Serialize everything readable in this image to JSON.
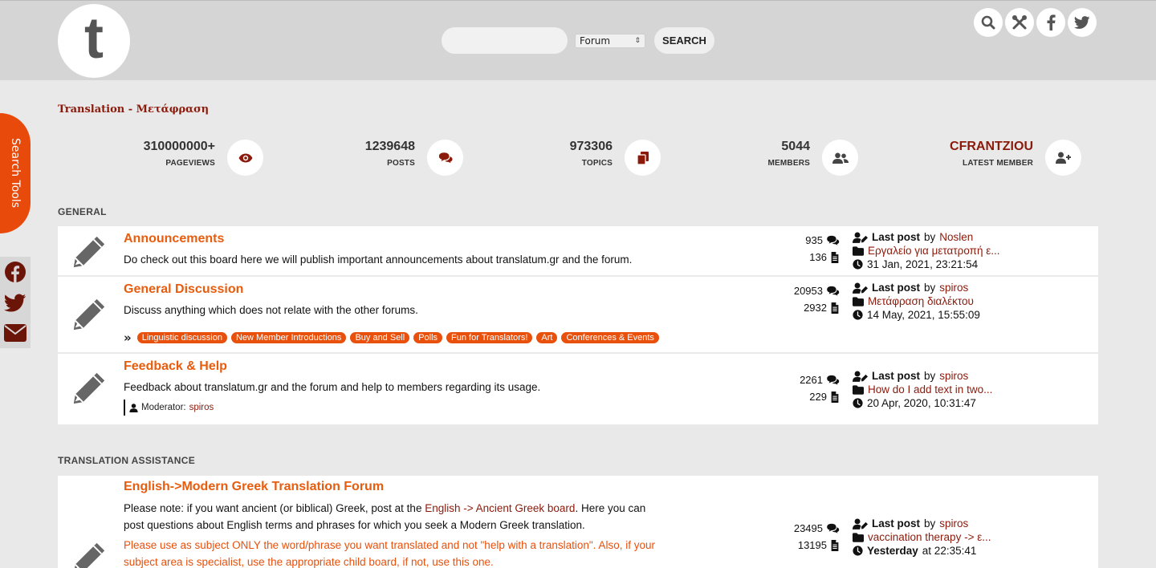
{
  "header": {
    "logo_letter": "t",
    "search_placeholder": "",
    "search_scope": "Forum",
    "search_button": "SEARCH",
    "icons": [
      "search-icon",
      "tools-icon",
      "facebook-icon",
      "twitter-icon"
    ]
  },
  "side": {
    "search_tools": "Search Tools",
    "social": [
      "facebook-icon",
      "twitter-icon",
      "envelope-icon"
    ]
  },
  "breadcrumb": "Translation - Μετάφραση",
  "stats": [
    {
      "value": "310000000+",
      "label": "PAGEVIEWS",
      "icon": "eye-icon"
    },
    {
      "value": "1239648",
      "label": "POSTS",
      "icon": "comments-icon"
    },
    {
      "value": "973306",
      "label": "TOPICS",
      "icon": "copy-icon"
    },
    {
      "value": "5044",
      "label": "MEMBERS",
      "icon": "users-icon"
    },
    {
      "value": "CFRANTZIOU",
      "label": "LATEST MEMBER",
      "icon": "user-plus-icon"
    }
  ],
  "sections": {
    "general": "GENERAL",
    "translation_assistance": "TRANSLATION ASSISTANCE"
  },
  "labels": {
    "last_post": "Last post",
    "by": "by",
    "moderator": "Moderator:",
    "subforum_marker": "»"
  },
  "forums": [
    {
      "title": "Announcements",
      "description": "Do check out this board here we will publish important announcements about translatum.gr and the forum.",
      "posts": "935",
      "topics": "136",
      "last_user": "Noslen",
      "last_topic": "Εργαλείο για μετατροπή ε...",
      "last_time": "31 Jan, 2021, 23:21:54"
    },
    {
      "title": "General Discussion",
      "description": "Discuss anything which does not relate with the other forums.",
      "subforums": [
        "Linguistic discussion",
        "New Member Introductions",
        "Buy and Sell",
        "Polls",
        "Fun for Translators!",
        "Art",
        "Conferences & Events"
      ],
      "posts": "20953",
      "topics": "2932",
      "last_user": "spiros",
      "last_topic": "Μετάφραση διαλέκτου",
      "last_time": "14 May, 2021, 15:55:09"
    },
    {
      "title": "Feedback & Help",
      "description": "Feedback about translatum.gr and the forum and help to members regarding its usage.",
      "moderator": "spiros",
      "posts": "2261",
      "topics": "229",
      "last_user": "spiros",
      "last_topic": "How do I add text in two...",
      "last_time": "20 Apr, 2020, 10:31:47"
    },
    {
      "title": "English->Modern Greek Translation Forum",
      "description_line1_pre": "Please note: if you want ancient (or biblical) Greek, post at the ",
      "description_line1_link": "English -> Ancient Greek board",
      "description_line1_post": ". Here you can",
      "description_line2": "post questions about English terms and phrases for which you seek a Modern Greek translation.",
      "notice_line1": "Please use as subject ONLY the word/phrase you want translated and not \"help with a translation\". Also, if your",
      "notice_line2": "subject area is specialist, use the appropriate child board, if not, use this one.",
      "posts": "23495",
      "topics": "13195",
      "last_user": "spiros",
      "last_topic": "vaccination therapy -> ε...",
      "last_time_day": "Yesterday",
      "last_time_rest": "at 22:35:41"
    }
  ],
  "colors": {
    "accent": "#e8500c",
    "dark_red": "#8b1a0b",
    "header_bg": "#d5d5d5",
    "page_bg": "#e9e9e9"
  }
}
